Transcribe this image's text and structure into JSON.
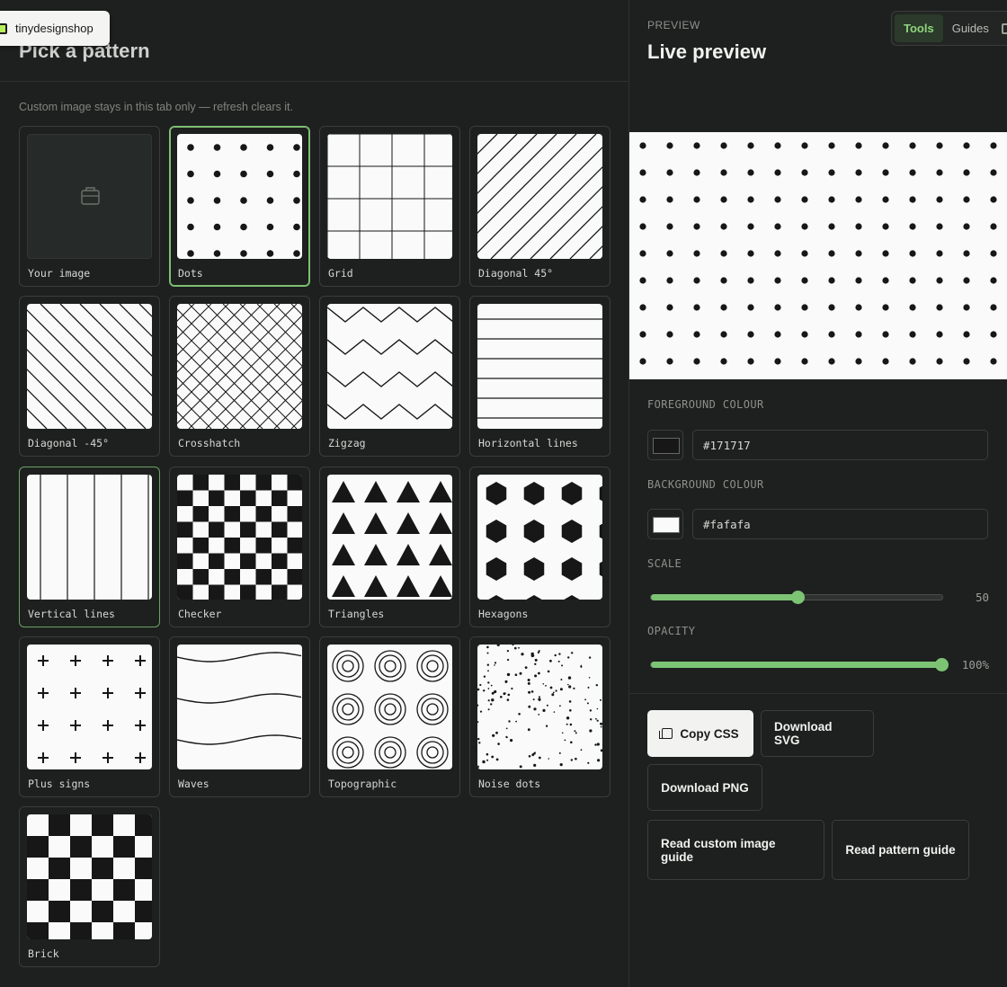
{
  "brand": {
    "name": "tinydesignshop"
  },
  "toolbar": {
    "tools": "Tools",
    "guides": "Guides"
  },
  "left": {
    "title": "Pick a pattern",
    "note": "Custom image stays in this tab only — refresh clears it."
  },
  "patterns": [
    {
      "label": "Your image"
    },
    {
      "label": "Dots"
    },
    {
      "label": "Grid"
    },
    {
      "label": "Diagonal 45°"
    },
    {
      "label": "Diagonal -45°"
    },
    {
      "label": "Crosshatch"
    },
    {
      "label": "Zigzag"
    },
    {
      "label": "Horizontal lines"
    },
    {
      "label": "Vertical lines"
    },
    {
      "label": "Checker"
    },
    {
      "label": "Triangles"
    },
    {
      "label": "Hexagons"
    },
    {
      "label": "Plus signs"
    },
    {
      "label": "Waves"
    },
    {
      "label": "Topographic"
    },
    {
      "label": "Noise dots"
    },
    {
      "label": "Brick"
    }
  ],
  "selected_pattern": "Dots",
  "preview": {
    "eyebrow": "PREVIEW",
    "title": "Live preview"
  },
  "controls": {
    "foreground_label": "FOREGROUND COLOUR",
    "foreground_value": "#171717",
    "background_label": "BACKGROUND COLOUR",
    "background_value": "#fafafa",
    "scale_label": "SCALE",
    "scale_value": "50",
    "scale_fraction": 0.5,
    "opacity_label": "OPACITY",
    "opacity_value": "100%",
    "opacity_fraction": 1.0
  },
  "actions": {
    "copy_css": "Copy CSS",
    "download_svg": "Download SVG",
    "download_png": "Download PNG",
    "read_custom_guide": "Read custom image guide",
    "read_pattern_guide": "Read pattern guide"
  },
  "colors": {
    "accent": "#7cc474",
    "foreground": "#171717",
    "background": "#fafafa"
  }
}
